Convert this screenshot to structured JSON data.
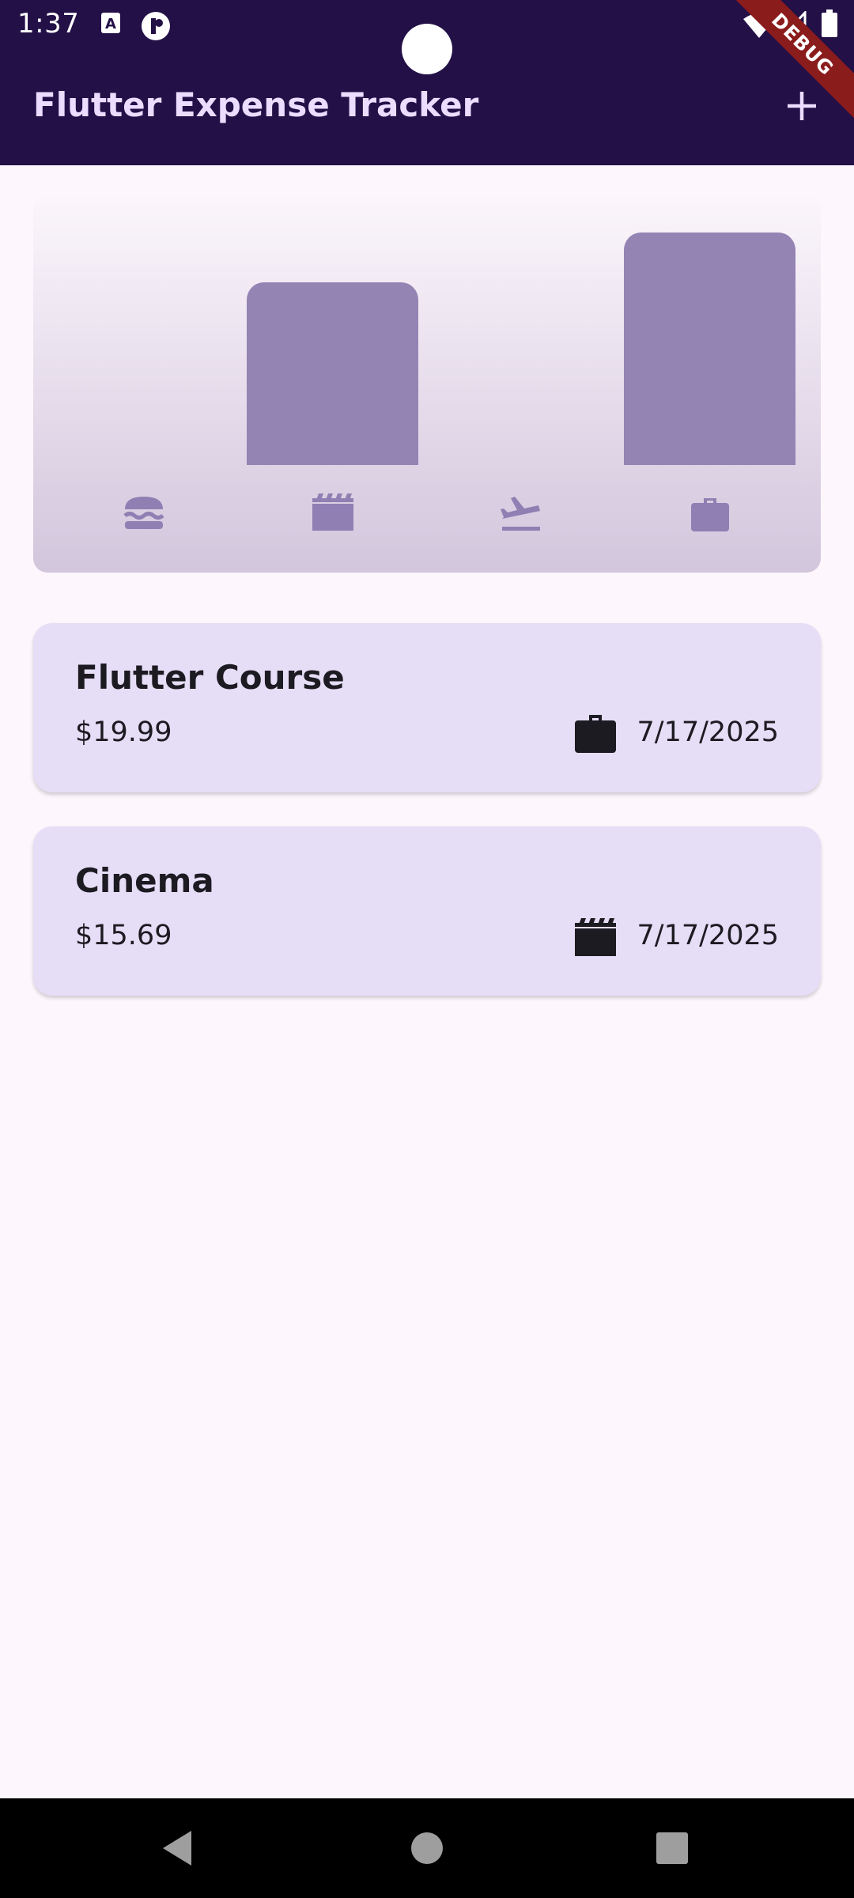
{
  "status_bar": {
    "time": "1:37",
    "icons": [
      "a-notification-icon",
      "circle-notification-icon",
      "wifi-icon",
      "signal-icon",
      "battery-icon"
    ]
  },
  "app_bar": {
    "title": "Flutter Expense Tracker",
    "add_icon": "plus-icon",
    "debug_banner": "DEBUG"
  },
  "chart_data": {
    "type": "bar",
    "categories": [
      "food-icon",
      "leisure-icon",
      "travel-icon",
      "work-icon"
    ],
    "values": [
      0,
      15.69,
      0,
      19.99
    ],
    "ylim": [
      0,
      19.99
    ],
    "bar_color": "#9384b4"
  },
  "expenses": [
    {
      "title": "Flutter Course",
      "amount": "$19.99",
      "category_icon": "briefcase-icon",
      "date": "7/17/2025"
    },
    {
      "title": "Cinema",
      "amount": "$15.69",
      "category_icon": "movie-clapper-icon",
      "date": "7/17/2025"
    }
  ],
  "colors": {
    "app_bar": "#231047",
    "title_text": "#ecdcff",
    "card": "#e6ddf6",
    "background": "#fdf7fd",
    "chart_icon": "#8f7fb3"
  },
  "nav_bar": {
    "buttons": [
      "back-icon",
      "home-icon",
      "recents-icon"
    ]
  }
}
